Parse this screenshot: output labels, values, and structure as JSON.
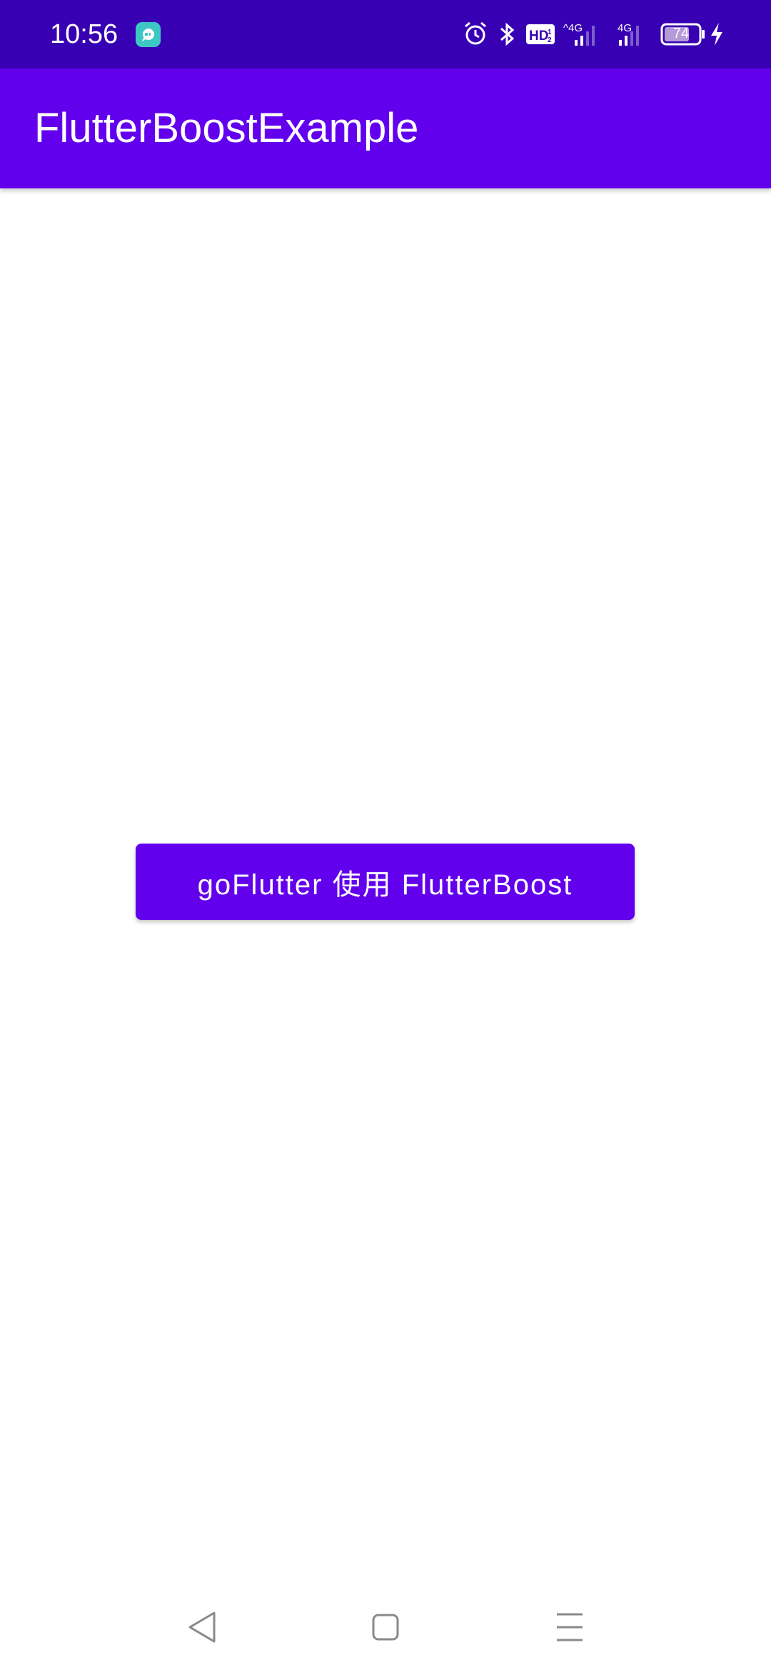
{
  "status_bar": {
    "time": "10:56",
    "battery_level": "74",
    "background_color": "#3700b3",
    "icons": [
      "app-notification-icon",
      "alarm-icon",
      "bluetooth-icon",
      "hd-volte-icon",
      "signal-4g-icon",
      "signal-4g-icon",
      "battery-icon",
      "charging-icon"
    ]
  },
  "app_bar": {
    "title": "FlutterBoostExample",
    "background_color": "#6200ee"
  },
  "main": {
    "go_flutter_button_label": "goFlutter 使用 FlutterBoost"
  },
  "nav_bar": {
    "buttons": [
      "back",
      "home",
      "recents"
    ]
  }
}
